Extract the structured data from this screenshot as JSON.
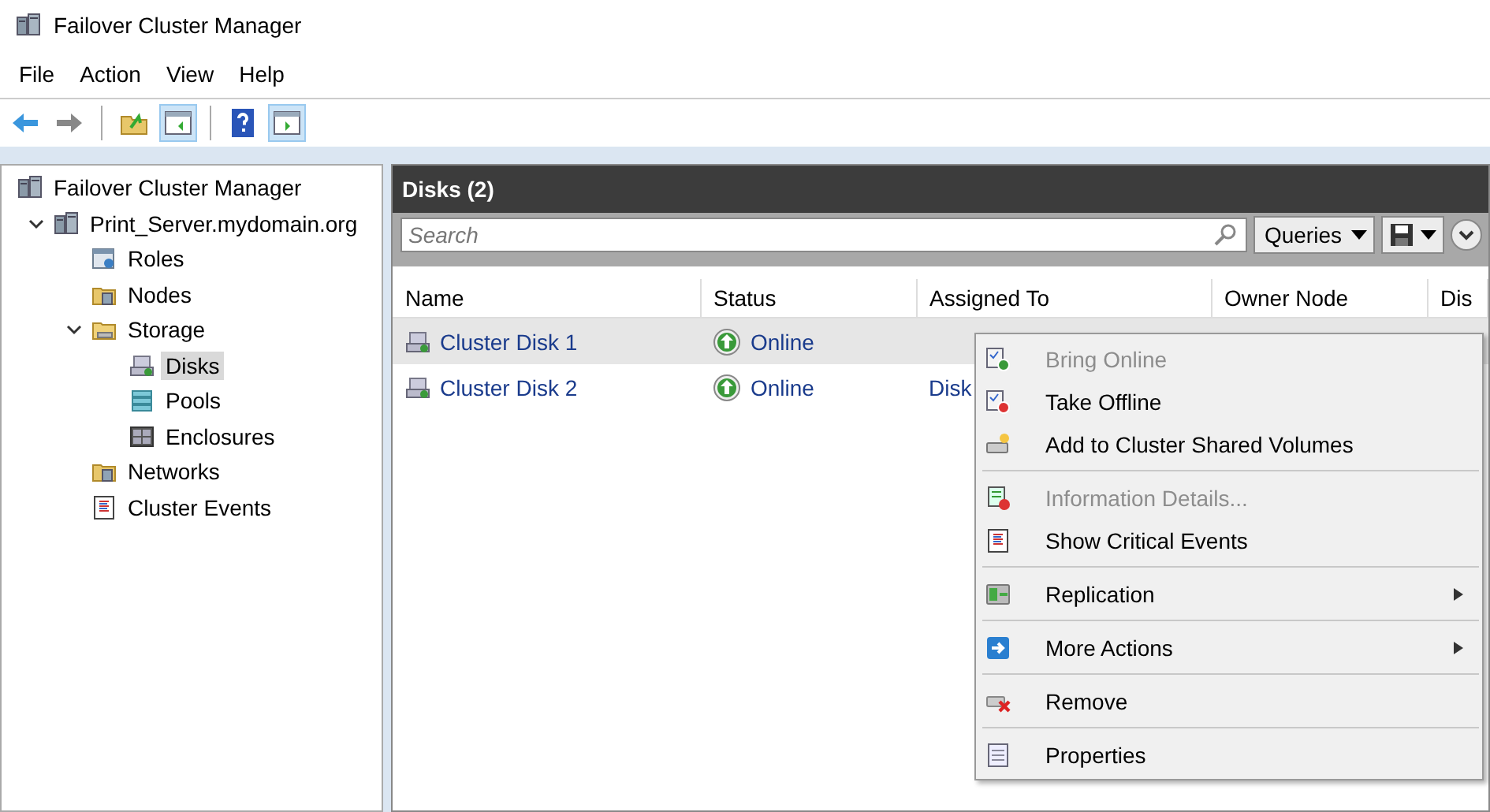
{
  "window": {
    "title": "Failover Cluster Manager"
  },
  "menu_bar": [
    "File",
    "Action",
    "View",
    "Help"
  ],
  "toolbar": [
    {
      "kind": "back",
      "selected": false
    },
    {
      "kind": "forward",
      "selected": false
    },
    {
      "kind": "separator"
    },
    {
      "kind": "up",
      "selected": false
    },
    {
      "kind": "pane",
      "selected": true
    },
    {
      "kind": "separator"
    },
    {
      "kind": "help",
      "selected": false
    },
    {
      "kind": "pane2",
      "selected": true
    }
  ],
  "tree": [
    {
      "label": "Failover Cluster Manager",
      "kind": "cluster",
      "selected": false,
      "children": [
        {
          "label": "Print_Server.mydomain.org",
          "kind": "server",
          "selected": false,
          "expanded": true,
          "children": [
            {
              "label": "Roles",
              "kind": "roles",
              "selected": false
            },
            {
              "label": "Nodes",
              "kind": "nodes",
              "selected": false
            },
            {
              "label": "Storage",
              "kind": "storage",
              "selected": false,
              "expanded": true,
              "children": [
                {
                  "label": "Disks",
                  "kind": "disk",
                  "selected": true
                },
                {
                  "label": "Pools",
                  "kind": "pools",
                  "selected": false
                },
                {
                  "label": "Enclosures",
                  "kind": "enclosures",
                  "selected": false
                }
              ]
            },
            {
              "label": "Networks",
              "kind": "networks",
              "selected": false
            },
            {
              "label": "Cluster Events",
              "kind": "events",
              "selected": false
            }
          ]
        }
      ]
    }
  ],
  "panel": {
    "title": "Disks (2)",
    "search": {
      "placeholder": "Search"
    },
    "queries_button": "Queries"
  },
  "table": {
    "columns": [
      "Name",
      "Status",
      "Assigned To",
      "Owner Node",
      "Dis"
    ],
    "rows": [
      {
        "name": "Cluster Disk 1",
        "status": "Online",
        "selected": true
      },
      {
        "name": "Cluster Disk 2",
        "status": "Online",
        "assigned_to": "Disk",
        "selected": false
      }
    ]
  },
  "context_menu": [
    {
      "kind": "bring-online",
      "label": "Bring Online",
      "disabled": true,
      "submenu": false
    },
    {
      "kind": "take-offline",
      "label": "Take Offline",
      "disabled": false,
      "submenu": false
    },
    {
      "kind": "add-csv",
      "label": "Add to Cluster Shared Volumes",
      "disabled": false,
      "submenu": false
    },
    {
      "kind": "separator"
    },
    {
      "kind": "info",
      "label": "Information Details...",
      "disabled": true,
      "submenu": false
    },
    {
      "kind": "events",
      "label": "Show Critical Events",
      "disabled": false,
      "submenu": false
    },
    {
      "kind": "separator"
    },
    {
      "kind": "replication",
      "label": "Replication",
      "disabled": false,
      "submenu": true
    },
    {
      "kind": "separator"
    },
    {
      "kind": "more",
      "label": "More Actions",
      "disabled": false,
      "submenu": true
    },
    {
      "kind": "separator"
    },
    {
      "kind": "remove",
      "label": "Remove",
      "disabled": false,
      "submenu": false
    },
    {
      "kind": "separator"
    },
    {
      "kind": "properties",
      "label": "Properties",
      "disabled": false,
      "submenu": false
    }
  ]
}
